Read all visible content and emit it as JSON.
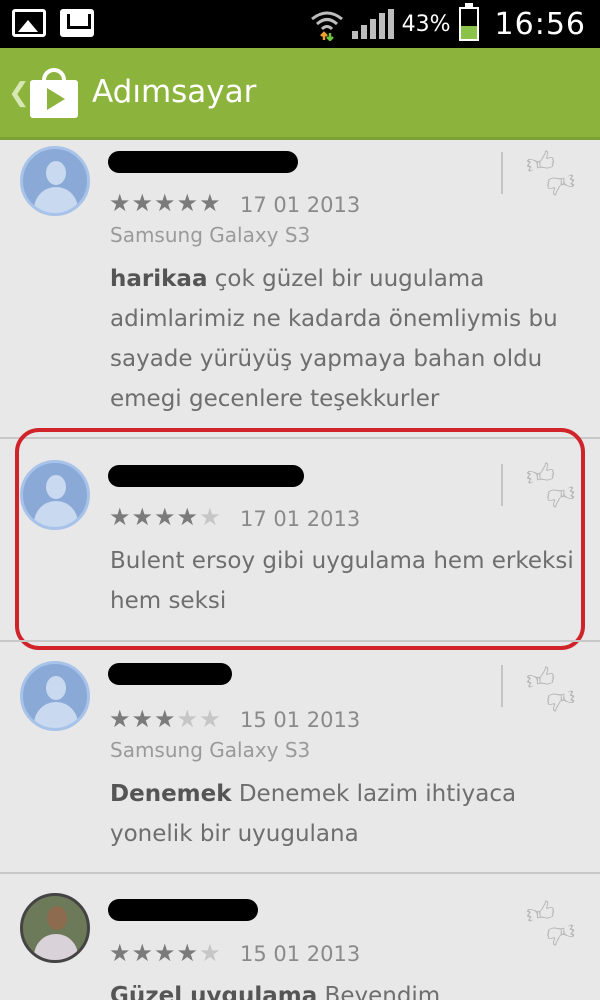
{
  "status_bar": {
    "battery": "43%",
    "time": "16:56"
  },
  "app_bar": {
    "title": "Adımsayar"
  },
  "reviews": [
    {
      "stars": {
        "on": "★★★★★",
        "off": ""
      },
      "date": "17 01 2013",
      "device": "Samsung Galaxy S3",
      "title": "harikaa",
      "text": " çok güzel bir uugulama adimlarimiz ne kadarda önemliymis bu sayade yürüyüş yapmaya bahan oldu emegi gecenlere teşekkurler"
    },
    {
      "stars": {
        "on": "★★★★",
        "off": "★"
      },
      "date": "17 01 2013",
      "device": "",
      "title": "",
      "text": "Bulent ersoy gibi uygulama hem erkeksi hem seksi"
    },
    {
      "stars": {
        "on": "★★★",
        "off": "★★"
      },
      "date": "15 01 2013",
      "device": "Samsung Galaxy S3",
      "title": "Denemek",
      "text": " Denemek lazim ihtiyaca yonelik bir uyugulana"
    },
    {
      "stars": {
        "on": "★★★★",
        "off": "★"
      },
      "date": "15 01 2013",
      "device": "",
      "title": "Güzel uygulama",
      "text": " Beyendim"
    }
  ],
  "icons": {
    "thumbs": "thumbs-up-down-icon",
    "avatar": "default-user-avatar-icon"
  }
}
